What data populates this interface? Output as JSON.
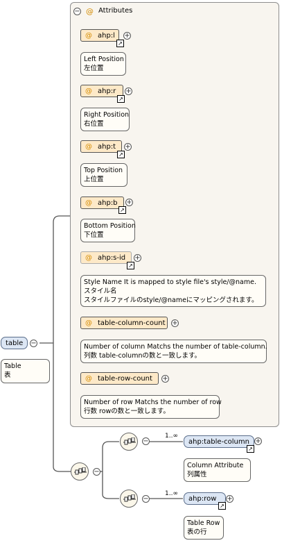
{
  "root": {
    "name": "table",
    "doc": [
      "Table",
      "表"
    ]
  },
  "attributes_group": {
    "header": "Attributes",
    "items": [
      {
        "name": "ahp:l",
        "doc": [
          "Left Position",
          "左位置"
        ]
      },
      {
        "name": "ahp:r",
        "doc": [
          "Right Position",
          "右位置"
        ]
      },
      {
        "name": "ahp:t",
        "doc": [
          "Top Position",
          "上位置"
        ]
      },
      {
        "name": "ahp:b",
        "doc": [
          "Bottom Position",
          "下位置"
        ]
      },
      {
        "name": "ahp:s-id",
        "doc": [
          "Style Name It is mapped to style file's style/@name.",
          "スタイル名",
          "スタイルファイルのstyle/@nameにマッピングされます。"
        ]
      },
      {
        "name": "table-column-count",
        "doc": [
          "Number of column Matchs the number of table-column.",
          "列数 table-columnの数と一致します。"
        ]
      },
      {
        "name": "table-row-count",
        "doc": [
          "Number of row Matchs the number of row",
          "行数 rowの数と一致します。"
        ]
      }
    ]
  },
  "children": [
    {
      "name": "ahp:table-column",
      "multiplicity": "1..∞",
      "doc": [
        "Column Attribute",
        "列属性"
      ]
    },
    {
      "name": "ahp:row",
      "multiplicity": "1..∞",
      "doc": [
        "Table Row",
        "表の行"
      ]
    }
  ],
  "colors": {
    "attribute_fill": "#fde9c8",
    "element_fill": "#dce6f4",
    "group_fill": "#f8f5ef",
    "at_sign": "#d48b00"
  }
}
